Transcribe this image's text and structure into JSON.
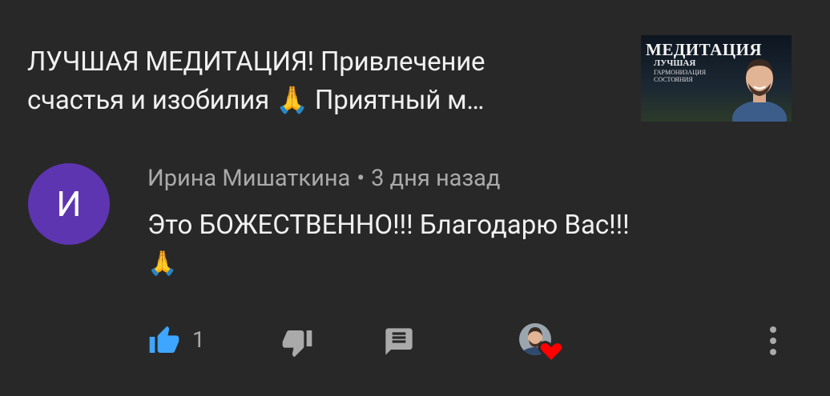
{
  "video": {
    "title_line1": "ЛУЧШАЯ МЕДИТАЦИЯ! Привлечение",
    "title_line2": "счастья и изобилия 🙏 Приятный м…",
    "thumbnail": {
      "heading": "МЕДИТАЦИЯ",
      "sub1": "ЛУЧШАЯ",
      "sub2": "ГАРМОНИЗАЦИЯ СОСТОЯНИЯ"
    }
  },
  "comment": {
    "avatar_letter": "И",
    "author": "Ирина Мишаткина",
    "separator": "•",
    "time": "3 дня назад",
    "text_line1": "Это БОЖЕСТВЕННО!!! Благодарю Вас!!!",
    "text_line2": "🙏",
    "like_count": "1"
  },
  "colors": {
    "background": "#282828",
    "avatar": "#5e35b1",
    "like_active": "#3ea6ff",
    "heart": "#ff0000",
    "icon_gray": "#aaaaaa"
  },
  "icons": [
    "thumbs-up-icon",
    "thumbs-down-icon",
    "reply-icon",
    "creator-heart-icon",
    "more-vert-icon"
  ]
}
